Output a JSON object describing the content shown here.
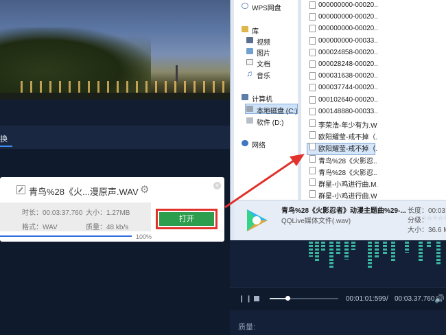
{
  "converter": {
    "tab_label": "换",
    "task": {
      "title": "青鸟%28《火...漫原声.WAV",
      "duration_label": "时长：00:03:37.760",
      "size_label": "大小：1.27MB",
      "format_label": "格式：WAV",
      "quality_label": "质量：48 kb/s",
      "open_button": "打开",
      "progress": 1.0,
      "progress_text": "100%",
      "close_glyph": "×"
    }
  },
  "player": {
    "elapsed": "00:01:01:599",
    "separator": "/",
    "total": "00:03.37.760",
    "quality_label": "质量:",
    "seek_progress": 0.27
  },
  "explorer": {
    "nav": {
      "wps": "WPS网盘",
      "library": "库",
      "video": "视频",
      "pictures": "图片",
      "documents": "文档",
      "music": "音乐",
      "computer": "计算机",
      "local_disk": "本地磁盘 (C:)",
      "software": "软件 (D:)",
      "network": "网络"
    },
    "files": [
      "000000000-00020...",
      "000000000-00020...",
      "000000000-00020...",
      "000000000-00033...",
      "000024858-00020...",
      "000028248-00020...",
      "000031638-00020...",
      "000037744-00020...",
      "000102640-00020...",
      "000148880-00033...",
      "李荣浩-年少有为.W...",
      "欧阳耀莹-戒不掉（...",
      "欧阳耀莹-戒不掉（...",
      "青鸟%28《火影忍...",
      "青鸟%28《火影忍...",
      "群星-小鸡进行曲.M...",
      "群星-小鸡进行曲.W..."
    ],
    "selected_index": 14,
    "details": {
      "file_name": "青鸟%28《火影忍者》动漫主题曲%29-...",
      "file_type": "QQLive媒体文件(.wav)",
      "duration_label": "长度：00:03:37",
      "rating_label": "分级：",
      "stars": "☆☆☆☆☆",
      "size_label": "大小：36.6 MB"
    }
  },
  "colors": {
    "accent_blue": "#2f6fdc",
    "open_green": "#2d9d4e",
    "annotation_red": "#e1322c"
  }
}
